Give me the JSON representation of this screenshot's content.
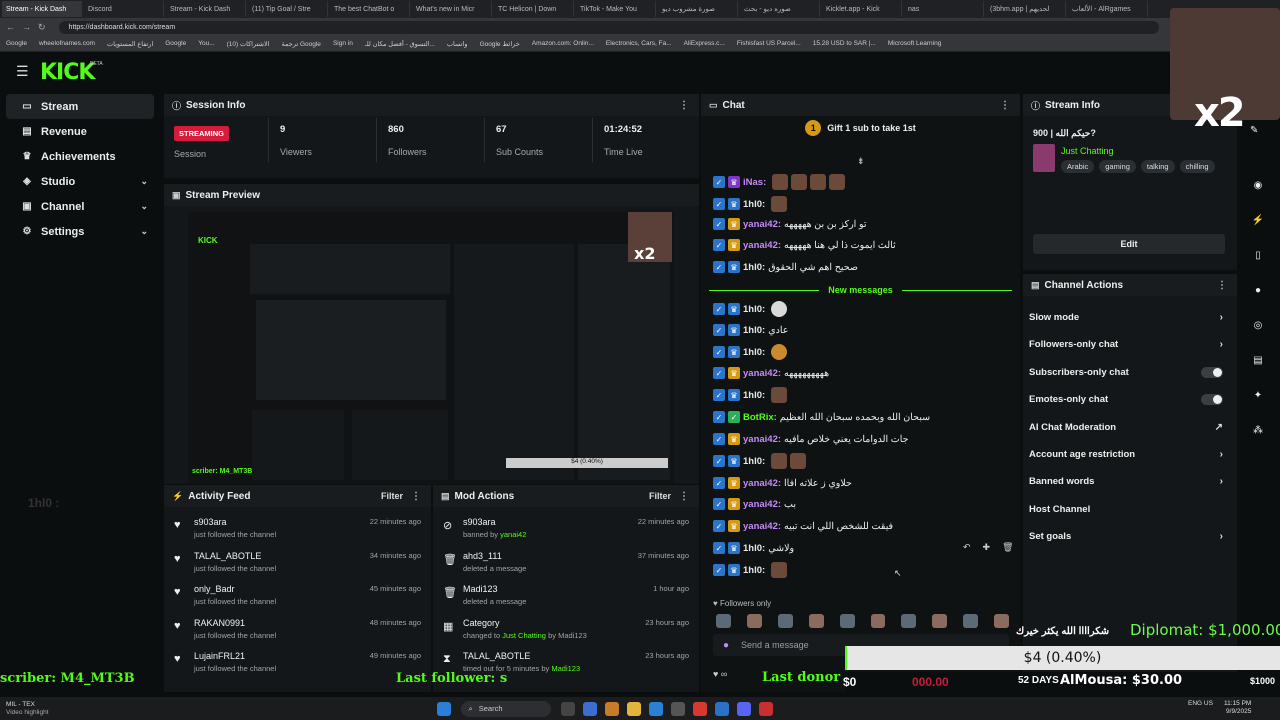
{
  "browser": {
    "tabs": [
      "Stream - Kick Dash",
      "Discord",
      "Stream - Kick Dash",
      "(11) Tip Goal / Stre",
      "The best ChatBot o",
      "What's new in Micr",
      "TC Helicon | Down",
      "TikTok - Make You",
      "صورة مشروب ديو",
      "صوره ديو - بحث",
      "Kicklet.app - Kick",
      "nas",
      "(3bhm.app | لحديهم",
      "الألعاب - AlRgames"
    ],
    "url": "https://dashboard.kick.com/stream",
    "bookmarks": [
      "Google",
      "wheelofnames.com",
      "ارتفاع المستويات",
      "Google",
      "You...",
      "الاشتراكات (10)",
      "ترجمة Google",
      "Sign in",
      "التسوق - أفضل مكان للـ...",
      "واتساب",
      "Google خرائط",
      "Amazon.com: Onlin...",
      "Electronics, Cars, Fa...",
      "AliExpress.c...",
      "Fishisfast US Parcel...",
      "15.28 USD to SAR |...",
      "Microsoft Learning"
    ]
  },
  "app": {
    "logo": "KICK",
    "beta": "BETA"
  },
  "sidebar": {
    "items": [
      {
        "label": "Stream",
        "icon": "stream-icon"
      },
      {
        "label": "Revenue",
        "icon": "revenue-icon"
      },
      {
        "label": "Achievements",
        "icon": "trophy-icon"
      },
      {
        "label": "Studio",
        "icon": "studio-icon"
      },
      {
        "label": "Channel",
        "icon": "channel-icon"
      },
      {
        "label": "Settings",
        "icon": "gear-icon"
      }
    ]
  },
  "session": {
    "title": "Session Info",
    "status": "STREAMING",
    "status_label": "Session",
    "viewers": "9",
    "viewers_label": "Viewers",
    "followers": "860",
    "followers_label": "Followers",
    "subs": "67",
    "subs_label": "Sub Counts",
    "time": "01:24:52",
    "time_label": "Time Live"
  },
  "preview": {
    "title": "Stream Preview"
  },
  "activity": {
    "title": "Activity Feed",
    "filter": "Filter",
    "items": [
      {
        "name": "s903ara",
        "text": "just followed the channel",
        "time": "22 minutes ago"
      },
      {
        "name": "TALAL_ABOTLE",
        "text": "just followed the channel",
        "time": "34 minutes ago"
      },
      {
        "name": "only_Badr",
        "text": "just followed the channel",
        "time": "45 minutes ago"
      },
      {
        "name": "RAKAN0991",
        "text": "just followed the channel",
        "time": "48 minutes ago"
      },
      {
        "name": "LujainFRL21",
        "text": "just followed the channel",
        "time": "49 minutes ago"
      }
    ]
  },
  "mod": {
    "title": "Mod Actions",
    "filter": "Filter",
    "items": [
      {
        "name": "s903ara",
        "pre": "banned by",
        "by": "yanai42",
        "post": "",
        "time": "22 minutes ago"
      },
      {
        "name": "ahd3_111",
        "pre": "deleted a message",
        "by": "",
        "post": "",
        "time": "37 minutes ago"
      },
      {
        "name": "Madi123",
        "pre": "deleted a message",
        "by": "",
        "post": "",
        "time": "1 hour ago"
      },
      {
        "name": "Category",
        "pre": "changed to",
        "by": "Just Chatting",
        "post": "by Madi123",
        "time": "23 hours ago"
      },
      {
        "name": "TALAL_ABOTLE",
        "pre": "timed out for 5 minutes by",
        "by": "Madi123",
        "post": "",
        "time": "23 hours ago"
      }
    ]
  },
  "chat": {
    "title": "Chat",
    "sub_banner_num": "1",
    "sub_banner": "Gift 1 sub to take 1st",
    "new_messages": "New messages",
    "followers_only": "Followers only",
    "send_placeholder": "Send a message",
    "messages": [
      {
        "user": "iNas",
        "color": "#c58af9",
        "text": "",
        "badge": "p",
        "emotes": 4
      },
      {
        "user": "1hl0",
        "color": "#e8e8e8",
        "text": "",
        "badge": "b",
        "emotes": 1
      },
      {
        "user": "yanai42",
        "color": "#c58af9",
        "text": "تو اركز بن بن هههههه",
        "badge": "y",
        "emotes": 0
      },
      {
        "user": "yanai42",
        "color": "#c58af9",
        "text": "ثالث ايموت ذا لي هنا هههههه",
        "badge": "y",
        "emotes": 0
      },
      {
        "user": "1hl0",
        "color": "#e8e8e8",
        "text": "صحيح اهم شي الحقوق",
        "badge": "b",
        "emotes": 0
      },
      {
        "user": "1hl0",
        "color": "#e8e8e8",
        "text": "",
        "badge": "b",
        "emotes": 1,
        "etype": "w"
      },
      {
        "user": "1hl0",
        "color": "#e8e8e8",
        "text": "عادي",
        "badge": "b",
        "emotes": 0
      },
      {
        "user": "1hl0",
        "color": "#e8e8e8",
        "text": "",
        "badge": "b",
        "emotes": 1,
        "etype": "s"
      },
      {
        "user": "yanai42",
        "color": "#c58af9",
        "text": "هههههههههه",
        "badge": "y",
        "emotes": 0
      },
      {
        "user": "1hl0",
        "color": "#e8e8e8",
        "text": "",
        "badge": "b",
        "emotes": 1
      },
      {
        "user": "BotRix",
        "color": "#53fc18",
        "text": "سبحان الله وبحمده سبحان الله العظيم",
        "badge": "g",
        "emotes": 0
      },
      {
        "user": "yanai42",
        "color": "#c58af9",
        "text": "جات الدوامات يعني خلاص مافيه",
        "badge": "y",
        "emotes": 0
      },
      {
        "user": "1hl0",
        "color": "#e8e8e8",
        "text": "",
        "badge": "b",
        "emotes": 2
      },
      {
        "user": "yanai42",
        "color": "#c58af9",
        "text": "حلاوي ز علاته افاا",
        "badge": "y",
        "emotes": 0
      },
      {
        "user": "yanai42",
        "color": "#c58af9",
        "text": "بب",
        "badge": "y",
        "emotes": 0
      },
      {
        "user": "yanai42",
        "color": "#c58af9",
        "text": "فيقت للشخص اللي انت تبيه",
        "badge": "y",
        "emotes": 0
      },
      {
        "user": "1hl0",
        "color": "#e8e8e8",
        "text": "ولاشي",
        "badge": "b",
        "emotes": 0
      },
      {
        "user": "1hl0",
        "color": "#e8e8e8",
        "text": "",
        "badge": "b",
        "emotes": 1
      }
    ]
  },
  "stream_info": {
    "title": "Stream Info",
    "stream_title": "حيكم الله | 900?",
    "category": "Just Chatting",
    "tags": [
      "Arabic",
      "gaming",
      "talking",
      "chilling"
    ],
    "edit": "Edit"
  },
  "channel_actions": {
    "title": "Channel Actions",
    "items": [
      {
        "label": "Slow mode",
        "ctrl": "chevron"
      },
      {
        "label": "Followers-only chat",
        "ctrl": "chevron"
      },
      {
        "label": "Subscribers-only chat",
        "ctrl": "toggle"
      },
      {
        "label": "Emotes-only chat",
        "ctrl": "toggle"
      },
      {
        "label": "AI Chat Moderation",
        "ctrl": "external"
      },
      {
        "label": "Account age restriction",
        "ctrl": "chevron"
      },
      {
        "label": "Banned words",
        "ctrl": "chevron"
      },
      {
        "label": "Host Channel",
        "ctrl": "none"
      },
      {
        "label": "Set goals",
        "ctrl": "chevron"
      }
    ]
  },
  "overlay": {
    "x2": "x2",
    "diplomat": "Diplomat: $1,000.00",
    "goal": "$4 (0.40%)",
    "goal_fraction": 0.004,
    "thanks": "شكراااا الله يكثر خيرك",
    "last_sub": "scriber: M4_MT3B",
    "last_follower": "Last follower: s",
    "last_donor": "Last donor s",
    "ticker": "52 DAYS",
    "donor_name": "AlMousa: $30.00",
    "amount_a": "$0",
    "amount_b": "000.00",
    "amount_c": "$1000",
    "bottom_left_1": "MIL - TEX",
    "bottom_left_2": "Video highlight"
  },
  "taskbar": {
    "search": "Search",
    "lang": "ENG US",
    "time": "11:15 PM",
    "date": "9/9/2025"
  }
}
